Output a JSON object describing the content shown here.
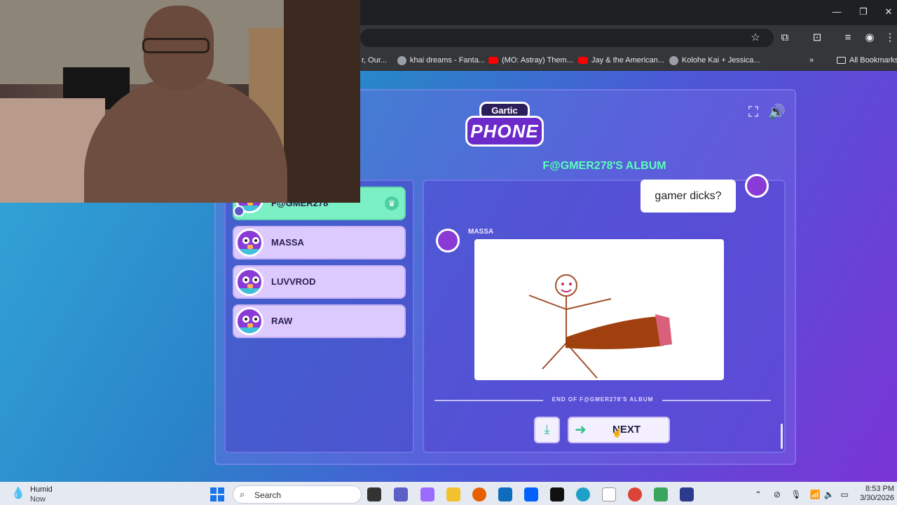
{
  "browser": {
    "window_controls": {
      "minimize": "—",
      "restore": "❐",
      "close": "✕"
    },
    "bookmarks": [
      {
        "label": "r, Our...",
        "icon": "globe-icon"
      },
      {
        "label": "khai dreams - Fanta...",
        "icon": "globe-icon"
      },
      {
        "label": "(MO: Astray) Them...",
        "icon": "youtube-icon"
      },
      {
        "label": "Jay & the American...",
        "icon": "youtube-icon"
      },
      {
        "label": "Kolohe Kai + Jessica...",
        "icon": "globe-icon"
      }
    ],
    "bookmarks_overflow": "»",
    "all_bookmarks": "All Bookmarks"
  },
  "game": {
    "logo_top": "Gartic",
    "logo_main": "PHONE",
    "album_title": "F@GMER278'S ALBUM",
    "players": [
      {
        "name": "F@GMER278",
        "active": true,
        "owner": true
      },
      {
        "name": "MASSA",
        "active": false
      },
      {
        "name": "LUVVROD",
        "active": false
      },
      {
        "name": "RAW",
        "active": false
      }
    ],
    "album": {
      "prompt_text": "gamer dicks?",
      "drawer_name": "MASSA",
      "end_text": "END OF F@GMER278'S ALBUM"
    },
    "buttons": {
      "next_label": "NEXT"
    },
    "colors": {
      "accent_green": "#59ffb9",
      "active_player": "#7bf0c5",
      "player_card": "#dccaff"
    }
  },
  "taskbar": {
    "weather_title": "Humid",
    "weather_sub": "Now",
    "search_placeholder": "Search",
    "time": "8:53 PM",
    "date": "3/30/2026"
  }
}
